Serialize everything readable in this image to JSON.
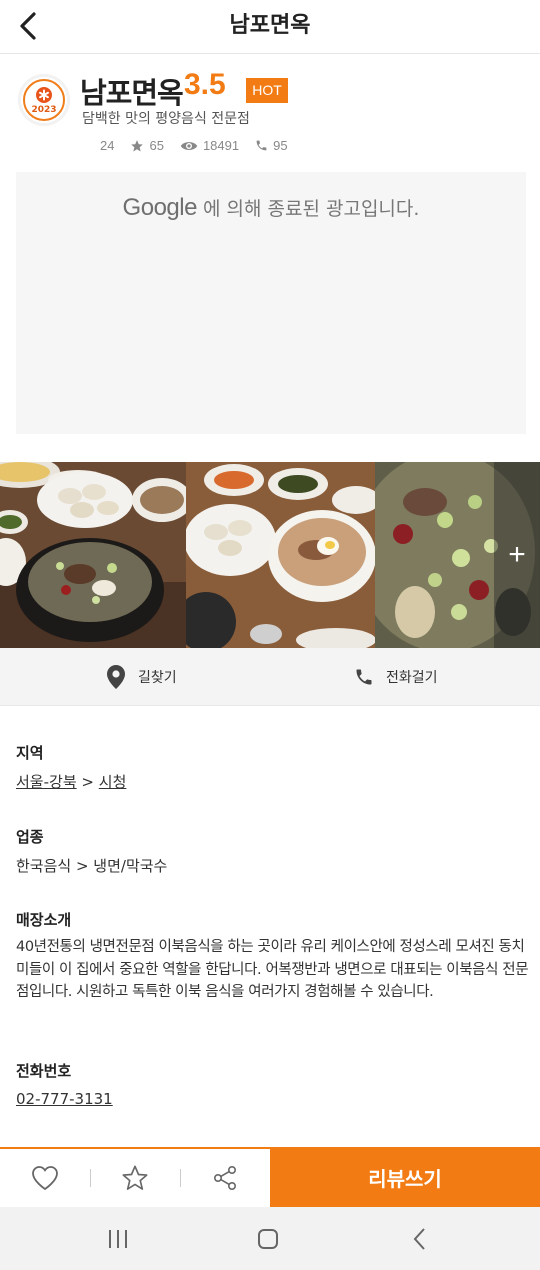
{
  "header": {
    "title": "남포면옥"
  },
  "store": {
    "logo_year": "2023",
    "name": "남포면옥",
    "rating": "3.5",
    "badge": "HOT",
    "description": "담백한 맛의 평양음식 전문점",
    "stats": {
      "reviews": "24",
      "favorites": "65",
      "views": "18491",
      "calls": "95"
    }
  },
  "ad": {
    "brand": "Google",
    "message": "에 의해 종료된 광고입니다."
  },
  "gallery": {
    "more_label": "+"
  },
  "actions": {
    "directions": "길찾기",
    "call": "전화걸기"
  },
  "info": {
    "region_label": "지역",
    "region_city": "서울-강북",
    "region_sep": ">",
    "region_area": "시청",
    "category_label": "업종",
    "category_value": "한국음식 > 냉면/막국수",
    "intro_label": "매장소개",
    "intro_text": "40년전통의 냉면전문점 이북음식을 하는 곳이라 유리 케이스안에 정성스레 모셔진 동치미들이 이 집에서 중요한 역할을 한답니다. 어복쟁반과 냉면으로 대표되는 이북음식 전문점입니다. 시원하고 독특한 이북 음식을 여러가지 경험해볼 수 있습니다.",
    "phone_label": "전화번호",
    "phone_value": "02-777-3131"
  },
  "bottom": {
    "review_button": "리뷰쓰기"
  },
  "colors": {
    "accent": "#f27b13",
    "text": "#222222",
    "muted": "#888888"
  }
}
